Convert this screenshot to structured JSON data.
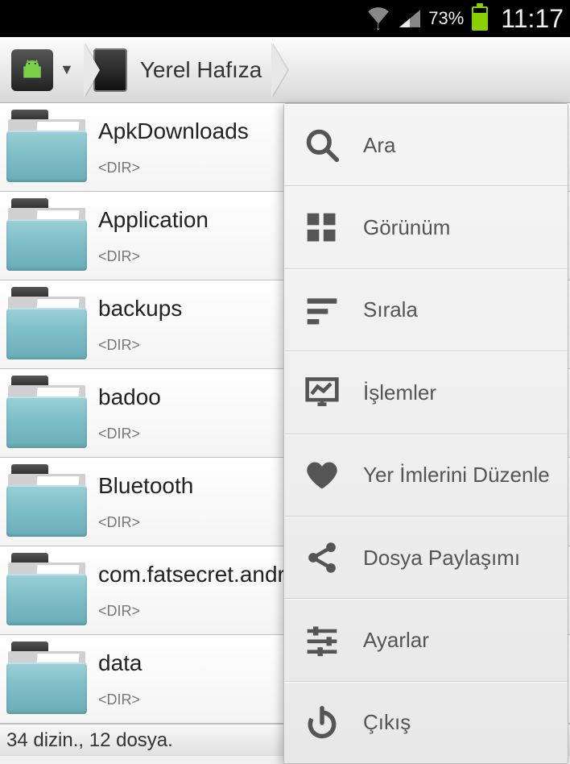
{
  "status": {
    "battery_pct": "73%",
    "clock": "11:17"
  },
  "breadcrumb": {
    "location_label": "Yerel Hafıza"
  },
  "files": [
    {
      "name": "ApkDownloads",
      "meta": "<DIR>"
    },
    {
      "name": "Application",
      "meta": "<DIR>"
    },
    {
      "name": "backups",
      "meta": "<DIR>"
    },
    {
      "name": "badoo",
      "meta": "<DIR>"
    },
    {
      "name": "Bluetooth",
      "meta": "<DIR>"
    },
    {
      "name": "com.fatsecret.andr",
      "meta": "<DIR>"
    },
    {
      "name": "data",
      "meta": "<DIR>"
    }
  ],
  "footer": {
    "summary": "34 dizin., 12 dosya."
  },
  "menu": [
    {
      "icon": "search-icon",
      "label": "Ara"
    },
    {
      "icon": "grid-icon",
      "label": "Görünüm"
    },
    {
      "icon": "sort-icon",
      "label": "Sırala"
    },
    {
      "icon": "chart-icon",
      "label": "İşlemler"
    },
    {
      "icon": "heart-icon",
      "label": "Yer İmlerini Düzenle"
    },
    {
      "icon": "share-icon",
      "label": "Dosya Paylaşımı"
    },
    {
      "icon": "sliders-icon",
      "label": "Ayarlar"
    },
    {
      "icon": "power-icon",
      "label": "Çıkış"
    }
  ]
}
